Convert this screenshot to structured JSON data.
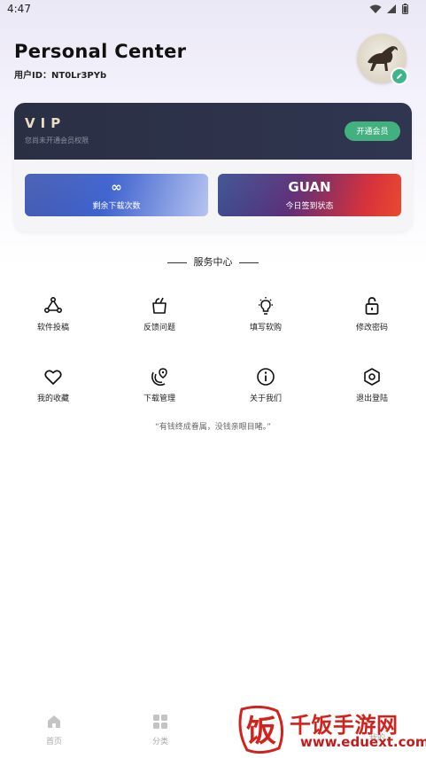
{
  "status_bar": {
    "time": "4:47"
  },
  "header": {
    "title": "Personal Center",
    "user_id": "用户ID：NT0Lr3PYb"
  },
  "vip": {
    "title": "VIP",
    "subtitle": "您尚未开通会员权限",
    "button": "开通会员"
  },
  "stats": {
    "downloads": {
      "value": "∞",
      "label": "剩余下载次数"
    },
    "checkin": {
      "value": "GUAN",
      "label": "今日签到状态"
    }
  },
  "service": {
    "title": "服务中心",
    "items": [
      {
        "label": "软件投稿",
        "icon": "share-nodes-icon"
      },
      {
        "label": "反馈问题",
        "icon": "feedback-cup-icon"
      },
      {
        "label": "填写软购",
        "icon": "lightbulb-icon"
      },
      {
        "label": "修改密码",
        "icon": "lock-icon"
      },
      {
        "label": "我的收藏",
        "icon": "heart-icon"
      },
      {
        "label": "下载管理",
        "icon": "download-location-icon"
      },
      {
        "label": "关于我们",
        "icon": "info-icon"
      },
      {
        "label": "退出登陆",
        "icon": "logout-hexagon-icon"
      }
    ]
  },
  "quote": "“有钱终成眷属，没钱亲眼目睹。”",
  "bottom_nav": {
    "home": "首页",
    "category": "分类",
    "mine": "我的"
  },
  "watermark": {
    "text": "千饭手游网",
    "url": "www.eduext.com",
    "logo_char": "饭"
  },
  "colors": {
    "accent_green": "#43b17f",
    "vip_bg": "#2a2f44",
    "watermark_red": "#d3221c"
  }
}
